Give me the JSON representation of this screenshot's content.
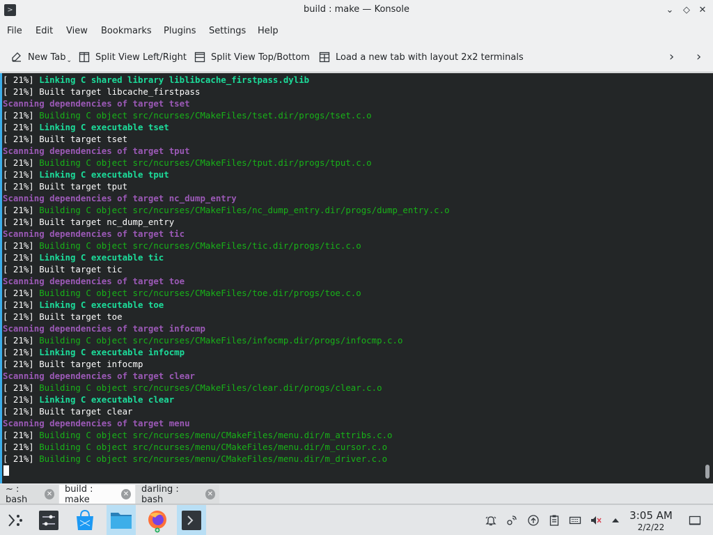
{
  "window": {
    "title": "build : make — Konsole"
  },
  "menubar": {
    "items": [
      "File",
      "Edit",
      "View",
      "Bookmarks",
      "Plugins",
      "Settings",
      "Help"
    ]
  },
  "toolbar": {
    "new_tab": "New Tab",
    "split_lr": "Split View Left/Right",
    "split_tb": "Split View Top/Bottom",
    "layout_2x2": "Load a new tab with layout 2x2 terminals"
  },
  "terminal": {
    "lines": [
      {
        "p": "[ 21%] ",
        "t": "Linking C shared library liblibcache_firstpass.dylib",
        "c": "lg"
      },
      {
        "p": "[ 21%] ",
        "t": "Built target libcache_firstpass",
        "c": "wh"
      },
      {
        "p": "",
        "t": "Scanning dependencies of target tset",
        "c": "pu"
      },
      {
        "p": "[ 21%] ",
        "t": "Building C object src/ncurses/CMakeFiles/tset.dir/progs/tset.c.o",
        "c": "gr"
      },
      {
        "p": "[ 21%] ",
        "t": "Linking C executable tset",
        "c": "lg"
      },
      {
        "p": "[ 21%] ",
        "t": "Built target tset",
        "c": "wh"
      },
      {
        "p": "",
        "t": "Scanning dependencies of target tput",
        "c": "pu"
      },
      {
        "p": "[ 21%] ",
        "t": "Building C object src/ncurses/CMakeFiles/tput.dir/progs/tput.c.o",
        "c": "gr"
      },
      {
        "p": "[ 21%] ",
        "t": "Linking C executable tput",
        "c": "lg"
      },
      {
        "p": "[ 21%] ",
        "t": "Built target tput",
        "c": "wh"
      },
      {
        "p": "",
        "t": "Scanning dependencies of target nc_dump_entry",
        "c": "pu"
      },
      {
        "p": "[ 21%] ",
        "t": "Building C object src/ncurses/CMakeFiles/nc_dump_entry.dir/progs/dump_entry.c.o",
        "c": "gr"
      },
      {
        "p": "[ 21%] ",
        "t": "Built target nc_dump_entry",
        "c": "wh"
      },
      {
        "p": "",
        "t": "Scanning dependencies of target tic",
        "c": "pu"
      },
      {
        "p": "[ 21%] ",
        "t": "Building C object src/ncurses/CMakeFiles/tic.dir/progs/tic.c.o",
        "c": "gr"
      },
      {
        "p": "[ 21%] ",
        "t": "Linking C executable tic",
        "c": "lg"
      },
      {
        "p": "[ 21%] ",
        "t": "Built target tic",
        "c": "wh"
      },
      {
        "p": "",
        "t": "Scanning dependencies of target toe",
        "c": "pu"
      },
      {
        "p": "[ 21%] ",
        "t": "Building C object src/ncurses/CMakeFiles/toe.dir/progs/toe.c.o",
        "c": "gr"
      },
      {
        "p": "[ 21%] ",
        "t": "Linking C executable toe",
        "c": "lg"
      },
      {
        "p": "[ 21%] ",
        "t": "Built target toe",
        "c": "wh"
      },
      {
        "p": "",
        "t": "Scanning dependencies of target infocmp",
        "c": "pu"
      },
      {
        "p": "[ 21%] ",
        "t": "Building C object src/ncurses/CMakeFiles/infocmp.dir/progs/infocmp.c.o",
        "c": "gr"
      },
      {
        "p": "[ 21%] ",
        "t": "Linking C executable infocmp",
        "c": "lg"
      },
      {
        "p": "[ 21%] ",
        "t": "Built target infocmp",
        "c": "wh"
      },
      {
        "p": "",
        "t": "Scanning dependencies of target clear",
        "c": "pu"
      },
      {
        "p": "[ 21%] ",
        "t": "Building C object src/ncurses/CMakeFiles/clear.dir/progs/clear.c.o",
        "c": "gr"
      },
      {
        "p": "[ 21%] ",
        "t": "Linking C executable clear",
        "c": "lg"
      },
      {
        "p": "[ 21%] ",
        "t": "Built target clear",
        "c": "wh"
      },
      {
        "p": "",
        "t": "Scanning dependencies of target menu",
        "c": "pu"
      },
      {
        "p": "[ 21%] ",
        "t": "Building C object src/ncurses/menu/CMakeFiles/menu.dir/m_attribs.c.o",
        "c": "gr"
      },
      {
        "p": "[ 21%] ",
        "t": "Building C object src/ncurses/menu/CMakeFiles/menu.dir/m_cursor.c.o",
        "c": "gr"
      },
      {
        "p": "[ 21%] ",
        "t": "Building C object src/ncurses/menu/CMakeFiles/menu.dir/m_driver.c.o",
        "c": "gr"
      }
    ]
  },
  "tabs": [
    {
      "label": "~ : bash",
      "active": false
    },
    {
      "label": "build : make",
      "active": true
    },
    {
      "label": "darling : bash",
      "active": false
    }
  ],
  "taskbar": {
    "time": "3:05 AM",
    "date": "2/2/22"
  },
  "colors": {
    "accent": "#3daee9",
    "terminal_bg": "#232627",
    "green": "#18b218",
    "bright_green": "#1cdc9a",
    "purple": "#9b59b6"
  }
}
